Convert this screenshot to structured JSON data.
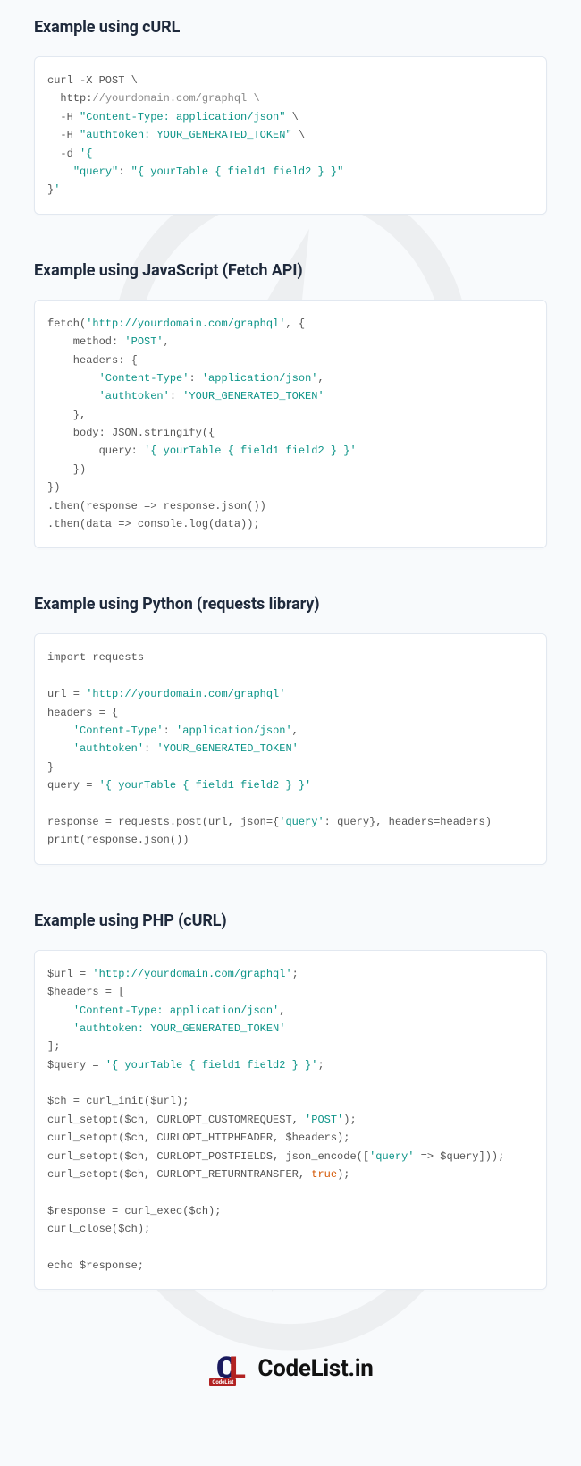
{
  "sections": [
    {
      "title": "Example using cURL",
      "code_html": "curl -X POST \\\n  http:<span class='c'>//yourdomain.com/graphql \\</span>\n  -H <span class='s'>\"Content-Type: application/json\"</span> \\\n  -H <span class='s'>\"authtoken: YOUR_GENERATED_TOKEN\"</span> \\\n  -d <span class='s'>'{</span>\n    <span class='s'>\"query\"</span>: <span class='s'>\"{ yourTable { field1 field2 } }\"</span>\n}<span class='s'>'</span>"
    },
    {
      "title": "Example using JavaScript (Fetch API)",
      "code_html": "fetch(<span class='s'>'http://yourdomain.com/graphql'</span>, {\n    method: <span class='s'>'POST'</span>,\n    headers: {\n        <span class='s'>'Content-Type'</span>: <span class='s'>'application/json'</span>,\n        <span class='s'>'authtoken'</span>: <span class='s'>'YOUR_GENERATED_TOKEN'</span>\n    },\n    body: JSON.stringify({\n        query: <span class='s'>'{ yourTable { field1 field2 } }'</span>\n    })\n})\n.then(response =&gt; response.json())\n.then(data =&gt; console.log(data));"
    },
    {
      "title": "Example using Python (requests library)",
      "code_html": "import requests\n\nurl = <span class='s'>'http://yourdomain.com/graphql'</span>\nheaders = {\n    <span class='s'>'Content-Type'</span>: <span class='s'>'application/json'</span>,\n    <span class='s'>'authtoken'</span>: <span class='s'>'YOUR_GENERATED_TOKEN'</span>\n}\nquery = <span class='s'>'{ yourTable { field1 field2 } }'</span>\n\nresponse = requests.post(url, json={<span class='s'>'query'</span>: query}, headers=headers)\nprint(response.json())"
    },
    {
      "title": "Example using PHP (cURL)",
      "code_html": "$url = <span class='s'>'http://yourdomain.com/graphql'</span>;\n$headers = [\n    <span class='s'>'Content-Type: application/json'</span>,\n    <span class='s'>'authtoken: YOUR_GENERATED_TOKEN'</span>\n];\n$query = <span class='s'>'{ yourTable { field1 field2 } }'</span>;\n\n$ch = curl_init($url);\ncurl_setopt($ch, CURLOPT_CUSTOMREQUEST, <span class='s'>'POST'</span>);\ncurl_setopt($ch, CURLOPT_HTTPHEADER, $headers);\ncurl_setopt($ch, CURLOPT_POSTFIELDS, json_encode([<span class='s'>'query'</span> =&gt; $query]));\ncurl_setopt($ch, CURLOPT_RETURNTRANSFER, <span class='kw'>true</span>);\n\n$response = curl_exec($ch);\ncurl_close($ch);\n\necho $response;"
    }
  ],
  "footer": {
    "logo_c": "C",
    "logo_l": "L",
    "logo_tag": "CodeList",
    "logo_text": "CodeList.in"
  }
}
